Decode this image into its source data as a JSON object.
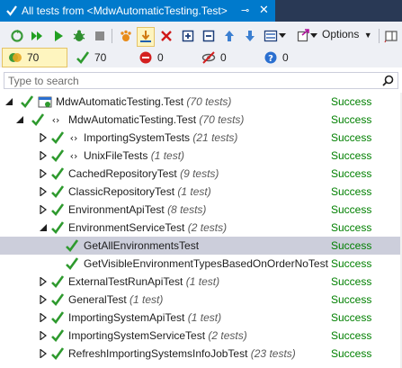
{
  "window": {
    "title": "All tests from <MdwAutomaticTesting.Test>",
    "pin_icon": "pin-icon",
    "close_icon": "close-icon"
  },
  "toolbar": {
    "options_label": "Options",
    "buttons": [
      "run-all",
      "run-selected",
      "run",
      "debug",
      "stop",
      "filter",
      "set-tree-root",
      "show-errors",
      "expand-all",
      "collapse-all",
      "previous",
      "next",
      "layout",
      "export"
    ]
  },
  "counts": {
    "total": "70",
    "passed": "70",
    "failed": "0",
    "ignored": "0",
    "inconclusive": "0"
  },
  "search": {
    "placeholder": "Type to search"
  },
  "tree": {
    "rows": [
      {
        "name": "MdwAutomaticTesting.Test",
        "count": "(70 tests)",
        "status": "Success"
      },
      {
        "name": "MdwAutomaticTesting.Test",
        "count": "(70 tests)",
        "status": "Success"
      },
      {
        "name": "ImportingSystemTests",
        "count": "(21 tests)",
        "status": "Success"
      },
      {
        "name": "UnixFileTests",
        "count": "(1 test)",
        "status": "Success"
      },
      {
        "name": "CachedRepositoryTest",
        "count": "(9 tests)",
        "status": "Success"
      },
      {
        "name": "ClassicRepositoryTest",
        "count": "(1 test)",
        "status": "Success"
      },
      {
        "name": "EnvironmentApiTest",
        "count": "(8 tests)",
        "status": "Success"
      },
      {
        "name": "EnvironmentServiceTest",
        "count": "(2 tests)",
        "status": "Success"
      },
      {
        "name": "GetAllEnvironmentsTest",
        "count": "",
        "status": "Success"
      },
      {
        "name": "GetVisibleEnvironmentTypesBasedOnOrderNoTest",
        "count": "",
        "status": "Success"
      },
      {
        "name": "ExternalTestRunApiTest",
        "count": "(1 test)",
        "status": "Success"
      },
      {
        "name": "GeneralTest",
        "count": "(1 test)",
        "status": "Success"
      },
      {
        "name": "ImportingSystemApiTest",
        "count": "(1 test)",
        "status": "Success"
      },
      {
        "name": "ImportingSystemServiceTest",
        "count": "(2 tests)",
        "status": "Success"
      },
      {
        "name": "RefreshImportingSystemsInfoJobTest",
        "count": "(23 tests)",
        "status": "Success"
      }
    ]
  },
  "colors": {
    "accent": "#007acc",
    "success": "#008000",
    "selected_row": "#cccedb"
  }
}
